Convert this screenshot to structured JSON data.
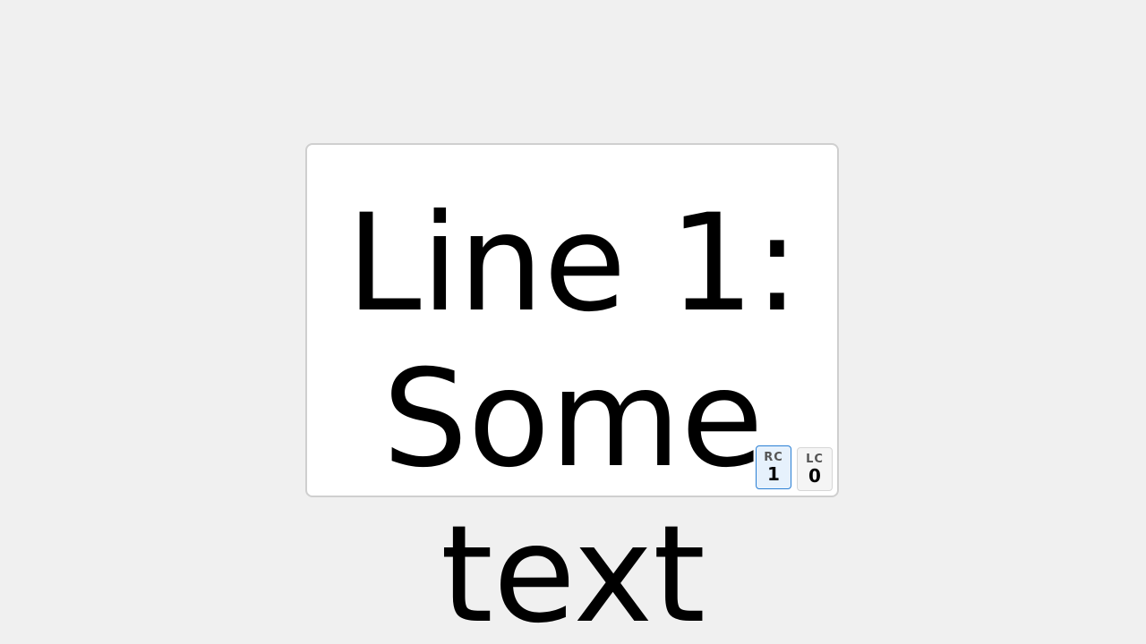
{
  "content": {
    "text": "Line 1: Some text"
  },
  "counters": {
    "rc": {
      "label": "RC",
      "value": "1"
    },
    "lc": {
      "label": "LC",
      "value": "0"
    }
  },
  "colors": {
    "background": "#f0f0f0",
    "card": "#ffffff",
    "rc_accent": "#2a7fd4",
    "rc_fill": "#e6f1fc"
  }
}
